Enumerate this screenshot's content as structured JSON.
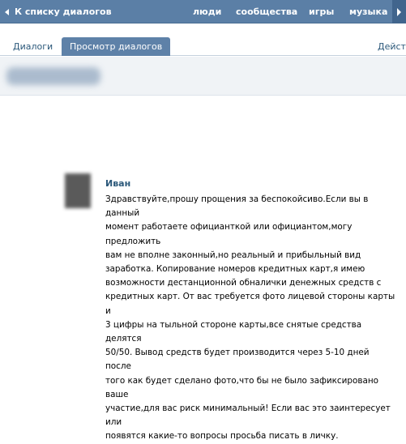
{
  "header": {
    "back_label": "К списку диалогов",
    "nav": [
      "люди",
      "сообщества",
      "игры",
      "музыка"
    ]
  },
  "tabs": {
    "dialogs": "Диалоги",
    "view": "Просмотр диалогов",
    "actions": "Действ"
  },
  "message": {
    "author": "Иван",
    "lines": [
      "Здравствуйте,прошу прощения за беспокойсиво.Если вы в данный",
      "момент работаете официанткой или официантом,могу предложить",
      "вам не вполне законный,но реальный и прибыльный вид",
      "заработка. Копирование номеров кредитных карт,я имею",
      "возможности дестанционной обналички денежных средств с",
      "кредитных карт. От вас требуется фото лицевой стороны карты и",
      "3 цифры на тыльной стороне карты,все снятые средства делятся",
      "50/50. Вывод средств будет производится через 5-10 дней после",
      "того как будет сделано фото,что бы не было зафиксировано ваше",
      "участие,для вас риск минимальный! Если вас это заинтересует или",
      "появятся какие-то вопросы просьба писать в личку."
    ]
  }
}
